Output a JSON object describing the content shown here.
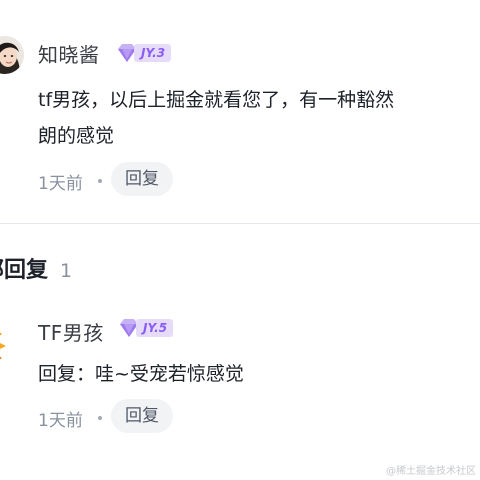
{
  "comments": [
    {
      "username": "知晓酱",
      "level": "JY.3",
      "text_line1": "tf男孩，以后上掘金就看您了，有一种豁然",
      "text_line2": "朗的感觉",
      "time": "1天前",
      "reply_label": "回复"
    }
  ],
  "replies_section": {
    "title": "部回复",
    "count": "1"
  },
  "replies": [
    {
      "username": "TF男孩",
      "level": "JY.5",
      "text": "回复：哇~受宠若惊感觉",
      "time": "1天前",
      "reply_label": "回复"
    }
  ],
  "watermark": "@稀土掘金技术社区",
  "colors": {
    "badge_bg": "#e6dcf9",
    "badge_text": "#8a5cf6",
    "meta_text": "#8a919f",
    "reply_btn_bg": "#f2f3f5",
    "tf_orange": "#f39c12"
  }
}
